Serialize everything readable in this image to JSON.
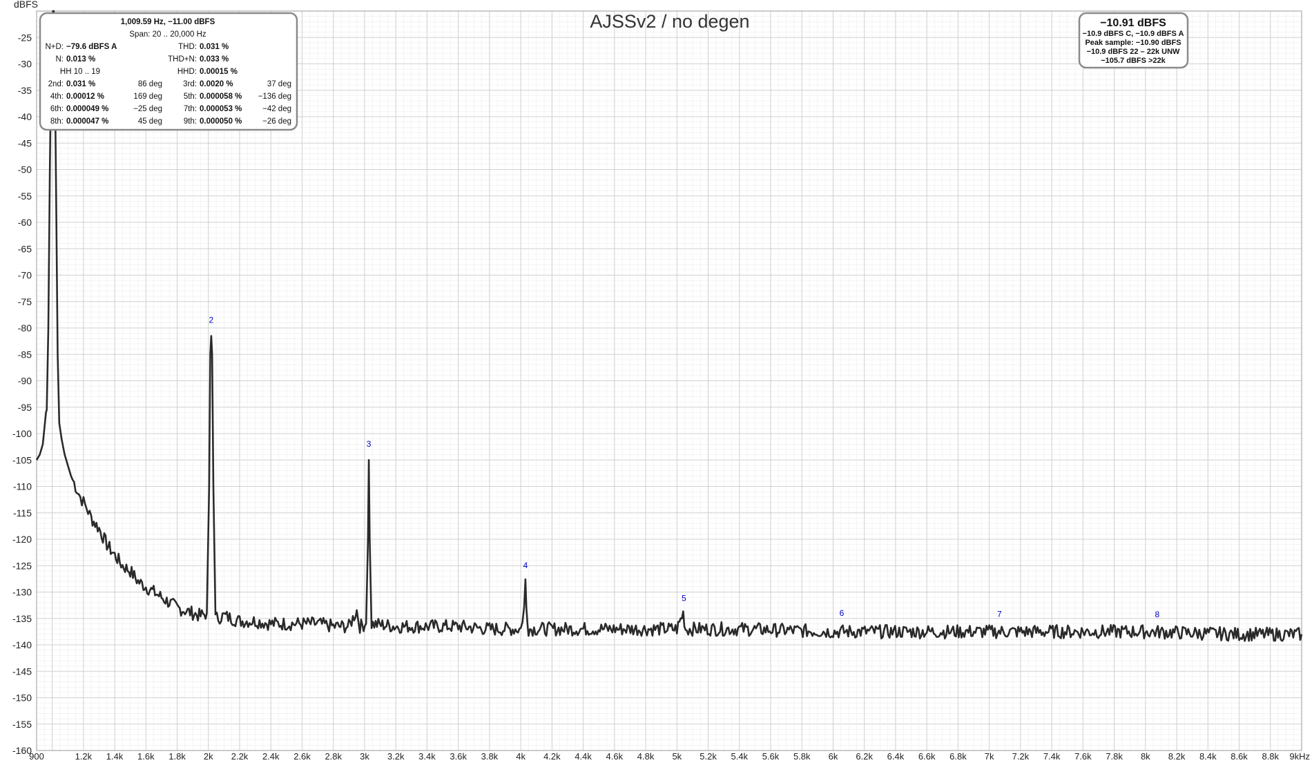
{
  "chart_data": {
    "type": "line",
    "title": "AJSSv2 / no degen",
    "ylabel": "dBFS",
    "xlabel": "",
    "x_unit": "Hz",
    "xlim": [
      900,
      9000
    ],
    "ylim": [
      -160,
      -20
    ],
    "grid": true,
    "y_ticks": [
      -25,
      -30,
      -35,
      -40,
      -45,
      -50,
      -55,
      -60,
      -65,
      -70,
      -75,
      -80,
      -85,
      -90,
      -95,
      -100,
      -105,
      -110,
      -115,
      -120,
      -125,
      -130,
      -135,
      -140,
      -145,
      -150,
      -155,
      -160
    ],
    "x_ticks": [
      {
        "v": 900,
        "label": "900"
      },
      {
        "v": 1200,
        "label": "1.2k"
      },
      {
        "v": 1400,
        "label": "1.4k"
      },
      {
        "v": 1600,
        "label": "1.6k"
      },
      {
        "v": 1800,
        "label": "1.8k"
      },
      {
        "v": 2000,
        "label": "2k"
      },
      {
        "v": 2200,
        "label": "2.2k"
      },
      {
        "v": 2400,
        "label": "2.4k"
      },
      {
        "v": 2600,
        "label": "2.6k"
      },
      {
        "v": 2800,
        "label": "2.8k"
      },
      {
        "v": 3000,
        "label": "3k"
      },
      {
        "v": 3200,
        "label": "3.2k"
      },
      {
        "v": 3400,
        "label": "3.4k"
      },
      {
        "v": 3600,
        "label": "3.6k"
      },
      {
        "v": 3800,
        "label": "3.8k"
      },
      {
        "v": 4000,
        "label": "4k"
      },
      {
        "v": 4200,
        "label": "4.2k"
      },
      {
        "v": 4400,
        "label": "4.4k"
      },
      {
        "v": 4600,
        "label": "4.6k"
      },
      {
        "v": 4800,
        "label": "4.8k"
      },
      {
        "v": 5000,
        "label": "5k"
      },
      {
        "v": 5200,
        "label": "5.2k"
      },
      {
        "v": 5400,
        "label": "5.4k"
      },
      {
        "v": 5600,
        "label": "5.6k"
      },
      {
        "v": 5800,
        "label": "5.8k"
      },
      {
        "v": 6000,
        "label": "6k"
      },
      {
        "v": 6200,
        "label": "6.2k"
      },
      {
        "v": 6400,
        "label": "6.4k"
      },
      {
        "v": 6600,
        "label": "6.6k"
      },
      {
        "v": 6800,
        "label": "6.8k"
      },
      {
        "v": 7000,
        "label": "7k"
      },
      {
        "v": 7200,
        "label": "7.2k"
      },
      {
        "v": 7400,
        "label": "7.4k"
      },
      {
        "v": 7600,
        "label": "7.6k"
      },
      {
        "v": 7800,
        "label": "7.8k"
      },
      {
        "v": 8000,
        "label": "8k"
      },
      {
        "v": 8200,
        "label": "8.2k"
      },
      {
        "v": 8400,
        "label": "8.4k"
      },
      {
        "v": 8600,
        "label": "8.6k"
      },
      {
        "v": 8800,
        "label": "8.8k"
      },
      {
        "v": 9000,
        "label": "9kHz"
      }
    ],
    "series": [
      {
        "color": "#2a2a2a",
        "points": [
          [
            900,
            -105
          ],
          [
            920,
            -104
          ],
          [
            940,
            -102
          ],
          [
            950,
            -99
          ],
          [
            960,
            -96
          ],
          [
            965,
            -95.5
          ],
          [
            975,
            -80
          ],
          [
            985,
            -50
          ],
          [
            995,
            -25
          ],
          [
            1005,
            -20
          ],
          [
            1010,
            -20
          ],
          [
            1015,
            -25
          ],
          [
            1025,
            -55
          ],
          [
            1035,
            -85
          ],
          [
            1045,
            -98
          ],
          [
            1060,
            -101
          ],
          [
            1080,
            -104
          ],
          [
            1100,
            -106
          ],
          [
            1120,
            -108
          ],
          [
            1150,
            -110
          ],
          [
            1180,
            -112
          ],
          [
            1200,
            -113
          ],
          [
            1220,
            -114
          ],
          [
            1250,
            -116
          ],
          [
            1300,
            -118
          ],
          [
            1350,
            -121
          ],
          [
            1400,
            -123
          ],
          [
            1450,
            -125
          ],
          [
            1500,
            -126
          ],
          [
            1550,
            -128
          ],
          [
            1600,
            -129
          ],
          [
            1650,
            -130
          ],
          [
            1700,
            -131
          ],
          [
            1750,
            -132
          ],
          [
            1800,
            -133
          ],
          [
            1850,
            -133.5
          ],
          [
            1900,
            -134
          ],
          [
            1950,
            -134.5
          ],
          [
            1990,
            -134
          ],
          [
            2005,
            -110
          ],
          [
            2012,
            -85
          ],
          [
            2018,
            -81.5
          ],
          [
            2024,
            -85
          ],
          [
            2032,
            -110
          ],
          [
            2045,
            -135
          ],
          [
            2100,
            -134.5
          ],
          [
            2200,
            -135.5
          ],
          [
            2300,
            -135.5
          ],
          [
            2400,
            -136
          ],
          [
            2500,
            -136
          ],
          [
            2600,
            -136
          ],
          [
            2700,
            -136
          ],
          [
            2800,
            -136.5
          ],
          [
            2900,
            -136.5
          ],
          [
            2950,
            -133.5
          ],
          [
            2970,
            -136.5
          ],
          [
            3010,
            -136
          ],
          [
            3022,
            -120
          ],
          [
            3027,
            -105
          ],
          [
            3033,
            -120
          ],
          [
            3045,
            -136
          ],
          [
            3200,
            -136.5
          ],
          [
            3400,
            -136.5
          ],
          [
            3600,
            -136.5
          ],
          [
            3800,
            -137
          ],
          [
            4000,
            -137
          ],
          [
            4022,
            -133
          ],
          [
            4030,
            -128
          ],
          [
            4036,
            -133
          ],
          [
            4050,
            -137
          ],
          [
            4400,
            -137
          ],
          [
            4800,
            -137
          ],
          [
            5000,
            -137
          ],
          [
            5040,
            -134
          ],
          [
            5055,
            -137
          ],
          [
            5400,
            -137
          ],
          [
            6000,
            -137.5
          ],
          [
            6600,
            -137.5
          ],
          [
            7000,
            -137.5
          ],
          [
            7600,
            -137.5
          ],
          [
            8000,
            -137.5
          ],
          [
            8600,
            -138
          ],
          [
            9000,
            -138
          ]
        ]
      }
    ],
    "annotations": [
      {
        "text": "2",
        "x": 2018,
        "y": -79
      },
      {
        "text": "3",
        "x": 3027,
        "y": -102.5
      },
      {
        "text": "4",
        "x": 4030,
        "y": -125.5
      },
      {
        "text": "5",
        "x": 5045,
        "y": -131.7
      },
      {
        "text": "6",
        "x": 6055,
        "y": -134.5
      },
      {
        "text": "7",
        "x": 7065,
        "y": -134.7
      },
      {
        "text": "8",
        "x": 8075,
        "y": -134.8
      }
    ]
  },
  "stats_box": {
    "line1": "1,009.59 Hz, −11.00 dBFS",
    "line2": "Span: 20 .. 20,000 Hz",
    "nd_label": "N+D:",
    "nd_value": "−79.6 dBFS A",
    "thd_label": "THD:",
    "thd_value": "0.031 %",
    "n_label": "N:",
    "n_value": "0.013 %",
    "thdn_label": "THD+N:",
    "thdn_value": "0.033 %",
    "hh_label": "HH 10 .. 19",
    "hhd_label": "HHD:",
    "hhd_value": "0.00015 %",
    "harmonics": [
      {
        "l1": "2nd:",
        "v1": "0.031 %",
        "d1": "86 deg",
        "l2": "3rd:",
        "v2": "0.0020 %",
        "d2": "37 deg"
      },
      {
        "l1": "4th:",
        "v1": "0.00012 %",
        "d1": "169 deg",
        "l2": "5th:",
        "v2": "0.000058 %",
        "d2": "−136 deg"
      },
      {
        "l1": "6th:",
        "v1": "0.000049 %",
        "d1": "−25 deg",
        "l2": "7th:",
        "v2": "0.000053 %",
        "d2": "−42 deg"
      },
      {
        "l1": "8th:",
        "v1": "0.000047 %",
        "d1": "45 deg",
        "l2": "9th:",
        "v2": "0.000050 %",
        "d2": "−26 deg"
      }
    ]
  },
  "level_box": {
    "main": "−10.91 dBFS",
    "lines": [
      "−10.9 dBFS C, −10.9 dBFS A",
      "Peak sample: −10.90 dBFS",
      "−10.9 dBFS 22 – 22k UNW",
      "−105.7 dBFS >22k"
    ]
  },
  "colors": {
    "trace": "#2a2a2a",
    "grid": "#d9d9d9",
    "harmonic_label": "#0000c8",
    "box_border": "#8a8a8a"
  }
}
